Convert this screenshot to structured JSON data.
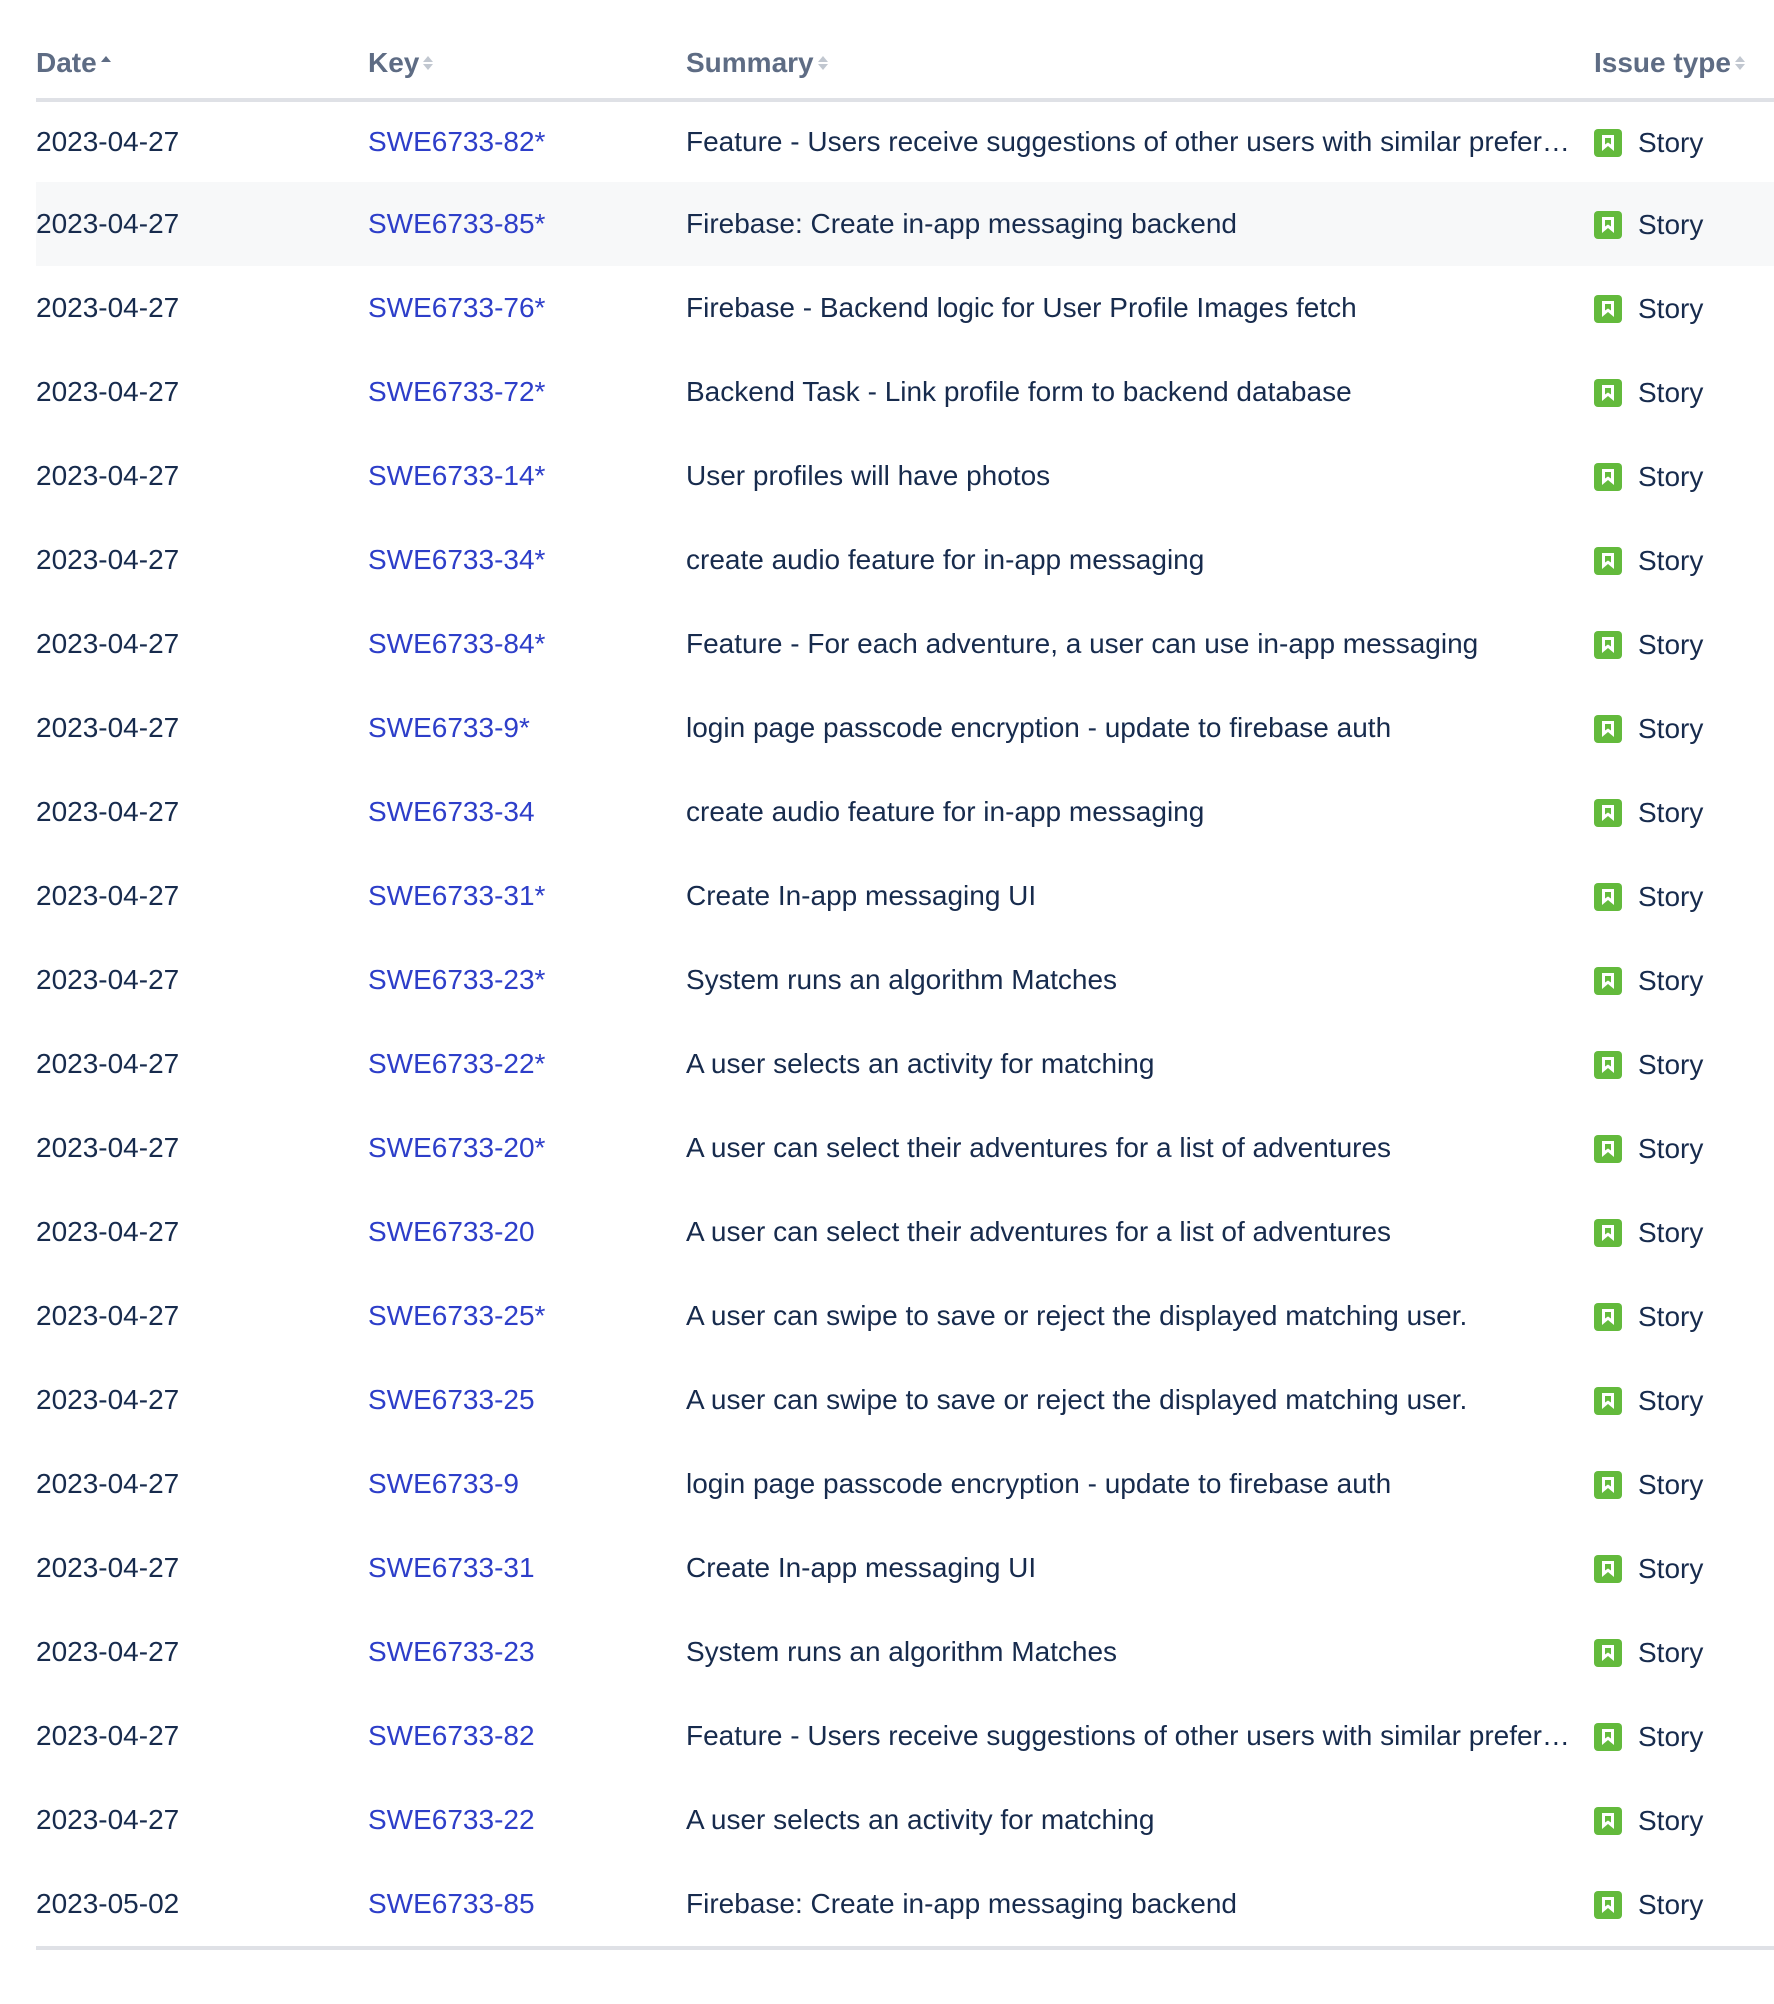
{
  "table": {
    "columns": {
      "date": "Date",
      "key": "Key",
      "summary": "Summary",
      "issue_type": "Issue type"
    },
    "sorted_by": "Date",
    "rows": [
      {
        "date": "2023-04-27",
        "key": "SWE6733-82*",
        "summary": "Feature - Users receive suggestions of other users with similar preferences",
        "type": "Story",
        "type_icon": "story-icon"
      },
      {
        "date": "2023-04-27",
        "key": "SWE6733-85*",
        "summary": "Firebase: Create in-app messaging backend",
        "type": "Story",
        "type_icon": "story-icon"
      },
      {
        "date": "2023-04-27",
        "key": "SWE6733-76*",
        "summary": "Firebase - Backend logic for User Profile Images fetch",
        "type": "Story",
        "type_icon": "story-icon"
      },
      {
        "date": "2023-04-27",
        "key": "SWE6733-72*",
        "summary": "Backend Task - Link profile form to backend database",
        "type": "Story",
        "type_icon": "story-icon"
      },
      {
        "date": "2023-04-27",
        "key": "SWE6733-14*",
        "summary": "User profiles will have photos",
        "type": "Story",
        "type_icon": "story-icon"
      },
      {
        "date": "2023-04-27",
        "key": "SWE6733-34*",
        "summary": "create audio feature for in-app messaging",
        "type": "Story",
        "type_icon": "story-icon"
      },
      {
        "date": "2023-04-27",
        "key": "SWE6733-84*",
        "summary": "Feature - For each adventure, a user can use in-app messaging",
        "type": "Story",
        "type_icon": "story-icon"
      },
      {
        "date": "2023-04-27",
        "key": "SWE6733-9*",
        "summary": "login page passcode encryption - update to firebase auth",
        "type": "Story",
        "type_icon": "story-icon"
      },
      {
        "date": "2023-04-27",
        "key": "SWE6733-34",
        "summary": "create audio feature for in-app messaging",
        "type": "Story",
        "type_icon": "story-icon"
      },
      {
        "date": "2023-04-27",
        "key": "SWE6733-31*",
        "summary": "Create In-app messaging UI",
        "type": "Story",
        "type_icon": "story-icon"
      },
      {
        "date": "2023-04-27",
        "key": "SWE6733-23*",
        "summary": "System runs an algorithm Matches",
        "type": "Story",
        "type_icon": "story-icon"
      },
      {
        "date": "2023-04-27",
        "key": "SWE6733-22*",
        "summary": "A user selects an activity for matching",
        "type": "Story",
        "type_icon": "story-icon"
      },
      {
        "date": "2023-04-27",
        "key": "SWE6733-20*",
        "summary": "A user can select their adventures for a list of adventures",
        "type": "Story",
        "type_icon": "story-icon"
      },
      {
        "date": "2023-04-27",
        "key": "SWE6733-20",
        "summary": "A user can select their adventures for a list of adventures",
        "type": "Story",
        "type_icon": "story-icon"
      },
      {
        "date": "2023-04-27",
        "key": "SWE6733-25*",
        "summary": "A user can swipe to save or reject the displayed matching user.",
        "type": "Story",
        "type_icon": "story-icon"
      },
      {
        "date": "2023-04-27",
        "key": "SWE6733-25",
        "summary": "A user can swipe to save or reject the displayed matching user.",
        "type": "Story",
        "type_icon": "story-icon"
      },
      {
        "date": "2023-04-27",
        "key": "SWE6733-9",
        "summary": "login page passcode encryption - update to firebase auth",
        "type": "Story",
        "type_icon": "story-icon"
      },
      {
        "date": "2023-04-27",
        "key": "SWE6733-31",
        "summary": "Create In-app messaging UI",
        "type": "Story",
        "type_icon": "story-icon"
      },
      {
        "date": "2023-04-27",
        "key": "SWE6733-23",
        "summary": "System runs an algorithm Matches",
        "type": "Story",
        "type_icon": "story-icon"
      },
      {
        "date": "2023-04-27",
        "key": "SWE6733-82",
        "summary": "Feature - Users receive suggestions of other users with similar preferences",
        "type": "Story",
        "type_icon": "story-icon"
      },
      {
        "date": "2023-04-27",
        "key": "SWE6733-22",
        "summary": "A user selects an activity for matching",
        "type": "Story",
        "type_icon": "story-icon"
      },
      {
        "date": "2023-05-02",
        "key": "SWE6733-85",
        "summary": "Firebase: Create in-app messaging backend",
        "type": "Story",
        "type_icon": "story-icon"
      }
    ]
  },
  "colors": {
    "link": "#2d3ec9",
    "story_icon": "#63ba3c",
    "header_text": "#5e6c84",
    "body_text": "#172b4d",
    "row_hover": "#f7f8f9"
  }
}
